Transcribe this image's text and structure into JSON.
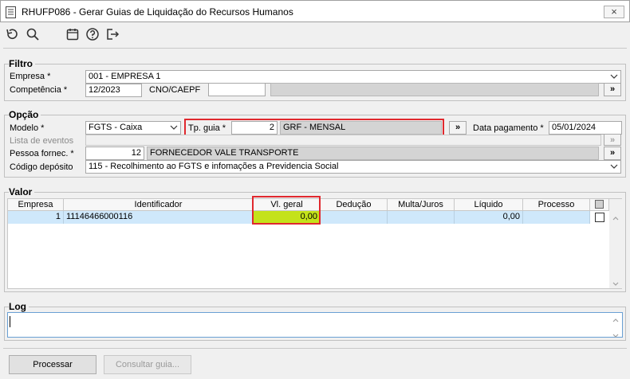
{
  "window": {
    "title": "RHUFP086 - Gerar Guias de Liquidação do Recursos Humanos",
    "close_glyph": "×"
  },
  "toolbar": {
    "icons": [
      "undo-icon",
      "search-icon",
      "calendar-icon",
      "help-icon",
      "exit-icon"
    ]
  },
  "filtro": {
    "title": "Filtro",
    "empresa_label": "Empresa *",
    "empresa_value": "001 - EMPRESA 1",
    "competencia_label": "Competência *",
    "competencia_value": "12/2023",
    "cno_label": "CNO/CAEPF",
    "cno_value": "",
    "lookup_glyph": "»"
  },
  "opcao": {
    "title": "Opção",
    "modelo_label": "Modelo *",
    "modelo_value": "FGTS - Caixa",
    "tp_guia_label": "Tp. guia *",
    "tp_guia_code": "2",
    "tp_guia_desc": "GRF - MENSAL",
    "data_pagamento_label": "Data pagamento *",
    "data_pagamento_value": "05/01/2024",
    "lista_eventos_label": "Lista de eventos",
    "pessoa_label": "Pessoa fornec. *",
    "pessoa_code": "12",
    "pessoa_desc": "FORNECEDOR VALE TRANSPORTE",
    "codigo_deposito_label": "Código depósito",
    "codigo_deposito_value": "115 - Recolhimento ao FGTS e infomações a Previdencia Social",
    "lookup_glyph": "»"
  },
  "valor": {
    "title": "Valor",
    "columns": [
      "Empresa",
      "Identificador",
      "Vl. geral",
      "Dedução",
      "Multa/Juros",
      "Líquido",
      "Processo"
    ],
    "rows": [
      {
        "empresa": "1",
        "identificador": "11146466000116",
        "vl_geral": "0,00",
        "deducao": "",
        "multa": "",
        "liquido": "0,00",
        "processo": ""
      }
    ]
  },
  "log": {
    "title": "Log",
    "value": ""
  },
  "buttons": {
    "processar": "Processar",
    "consultar": "Consultar guia..."
  },
  "colors": {
    "highlight": "#c4e21a",
    "red_outline": "#e0282e",
    "row_selected": "#cfe8fb"
  }
}
